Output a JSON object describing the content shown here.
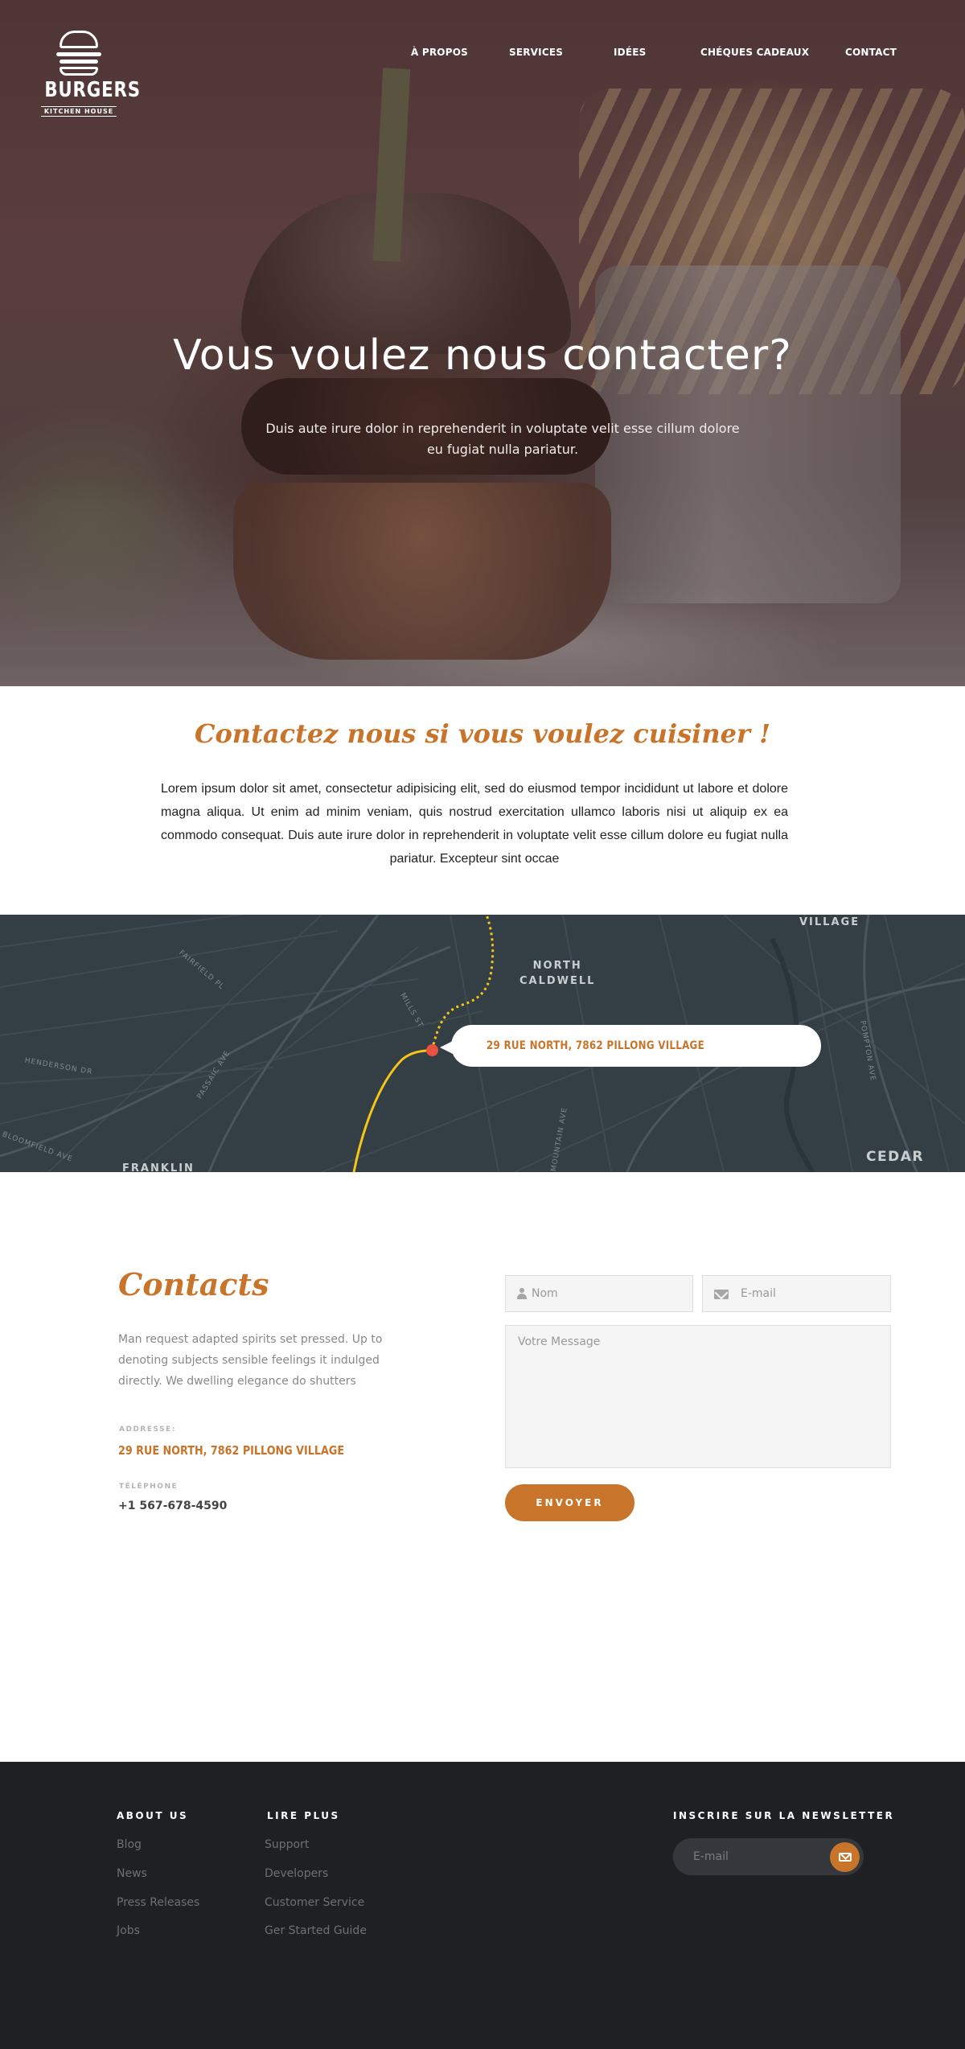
{
  "header": {
    "logo_name": "BURGERS",
    "logo_sub": "KITCHEN HOUSE",
    "nav": [
      {
        "label": "À PROPOS"
      },
      {
        "label": "SERVICES"
      },
      {
        "label": "IDÉES"
      },
      {
        "label": "CHÉQUES CADEAUX"
      },
      {
        "label": "CONTACT"
      }
    ]
  },
  "hero": {
    "title": "Vous voulez nous contacter?",
    "subtitle": "Duis aute irure dolor in reprehenderit in voluptate velit esse cillum dolore eu fugiat nulla pariatur."
  },
  "intro": {
    "title": "Contactez nous si vous voulez cuisiner !",
    "text": "Lorem ipsum dolor sit amet, consectetur adipisicing elit, sed do eiusmod tempor incididunt ut labore et dolore magna aliqua. Ut enim ad minim veniam, quis nostrud exercitation ullamco laboris nisi ut aliquip ex ea commodo consequat. Duis aute irure dolor in reprehenderit in voluptate velit esse cillum dolore eu fugiat nulla pariatur. Excepteur sint occae"
  },
  "map": {
    "address": "29 RUE NORTH, 7862 PILLONG VILLAGE",
    "labels": {
      "north_caldwell_1": "NORTH",
      "north_caldwell_2": "CALDWELL",
      "village": "VILLAGE",
      "cedar": "CEDAR",
      "franklin": "FRANKLIN",
      "passaic": "PASSAIC AVE",
      "bloomfield": "BLOOMFIELD AVE",
      "henderson": "HENDERSON DR",
      "fairfield": "FAIRFIELD PL",
      "pompton": "POMPTON AVE",
      "mountain": "MOUNTAIN AVE",
      "mills": "MILLS ST"
    }
  },
  "contacts": {
    "title": "Contacts",
    "description": "Man request adapted spirits set pressed. Up to denoting subjects sensible feelings it indulged directly. We dwelling elegance do shutters",
    "address_label": "ADDRESSE:",
    "address": "29 RUE NORTH, 7862 PILLONG VILLAGE",
    "phone_label": "TÉLÉPHONE",
    "phone": "+1 567-678-4590",
    "form": {
      "name_placeholder": "Nom",
      "email_placeholder": "E-mail",
      "message_placeholder": "Votre Message",
      "send_label": "ENVOYER"
    }
  },
  "footer": {
    "about_title": "ABOUT US",
    "about_links": [
      "Blog",
      "News",
      "Press Releases",
      "Jobs"
    ],
    "more_title": "LIRE PLUS",
    "more_links": [
      "Support",
      "Developers",
      "Customer Service",
      "Ger Started Guide"
    ],
    "newsletter_title": "INSCRIRE SUR LA NEWSLETTER",
    "newsletter_placeholder": "E-mail"
  },
  "colors": {
    "accent": "#c8752b",
    "map_bg": "#343e45",
    "footer_bg": "#1e2024",
    "route": "#f5c518",
    "pin": "#e8523e"
  }
}
